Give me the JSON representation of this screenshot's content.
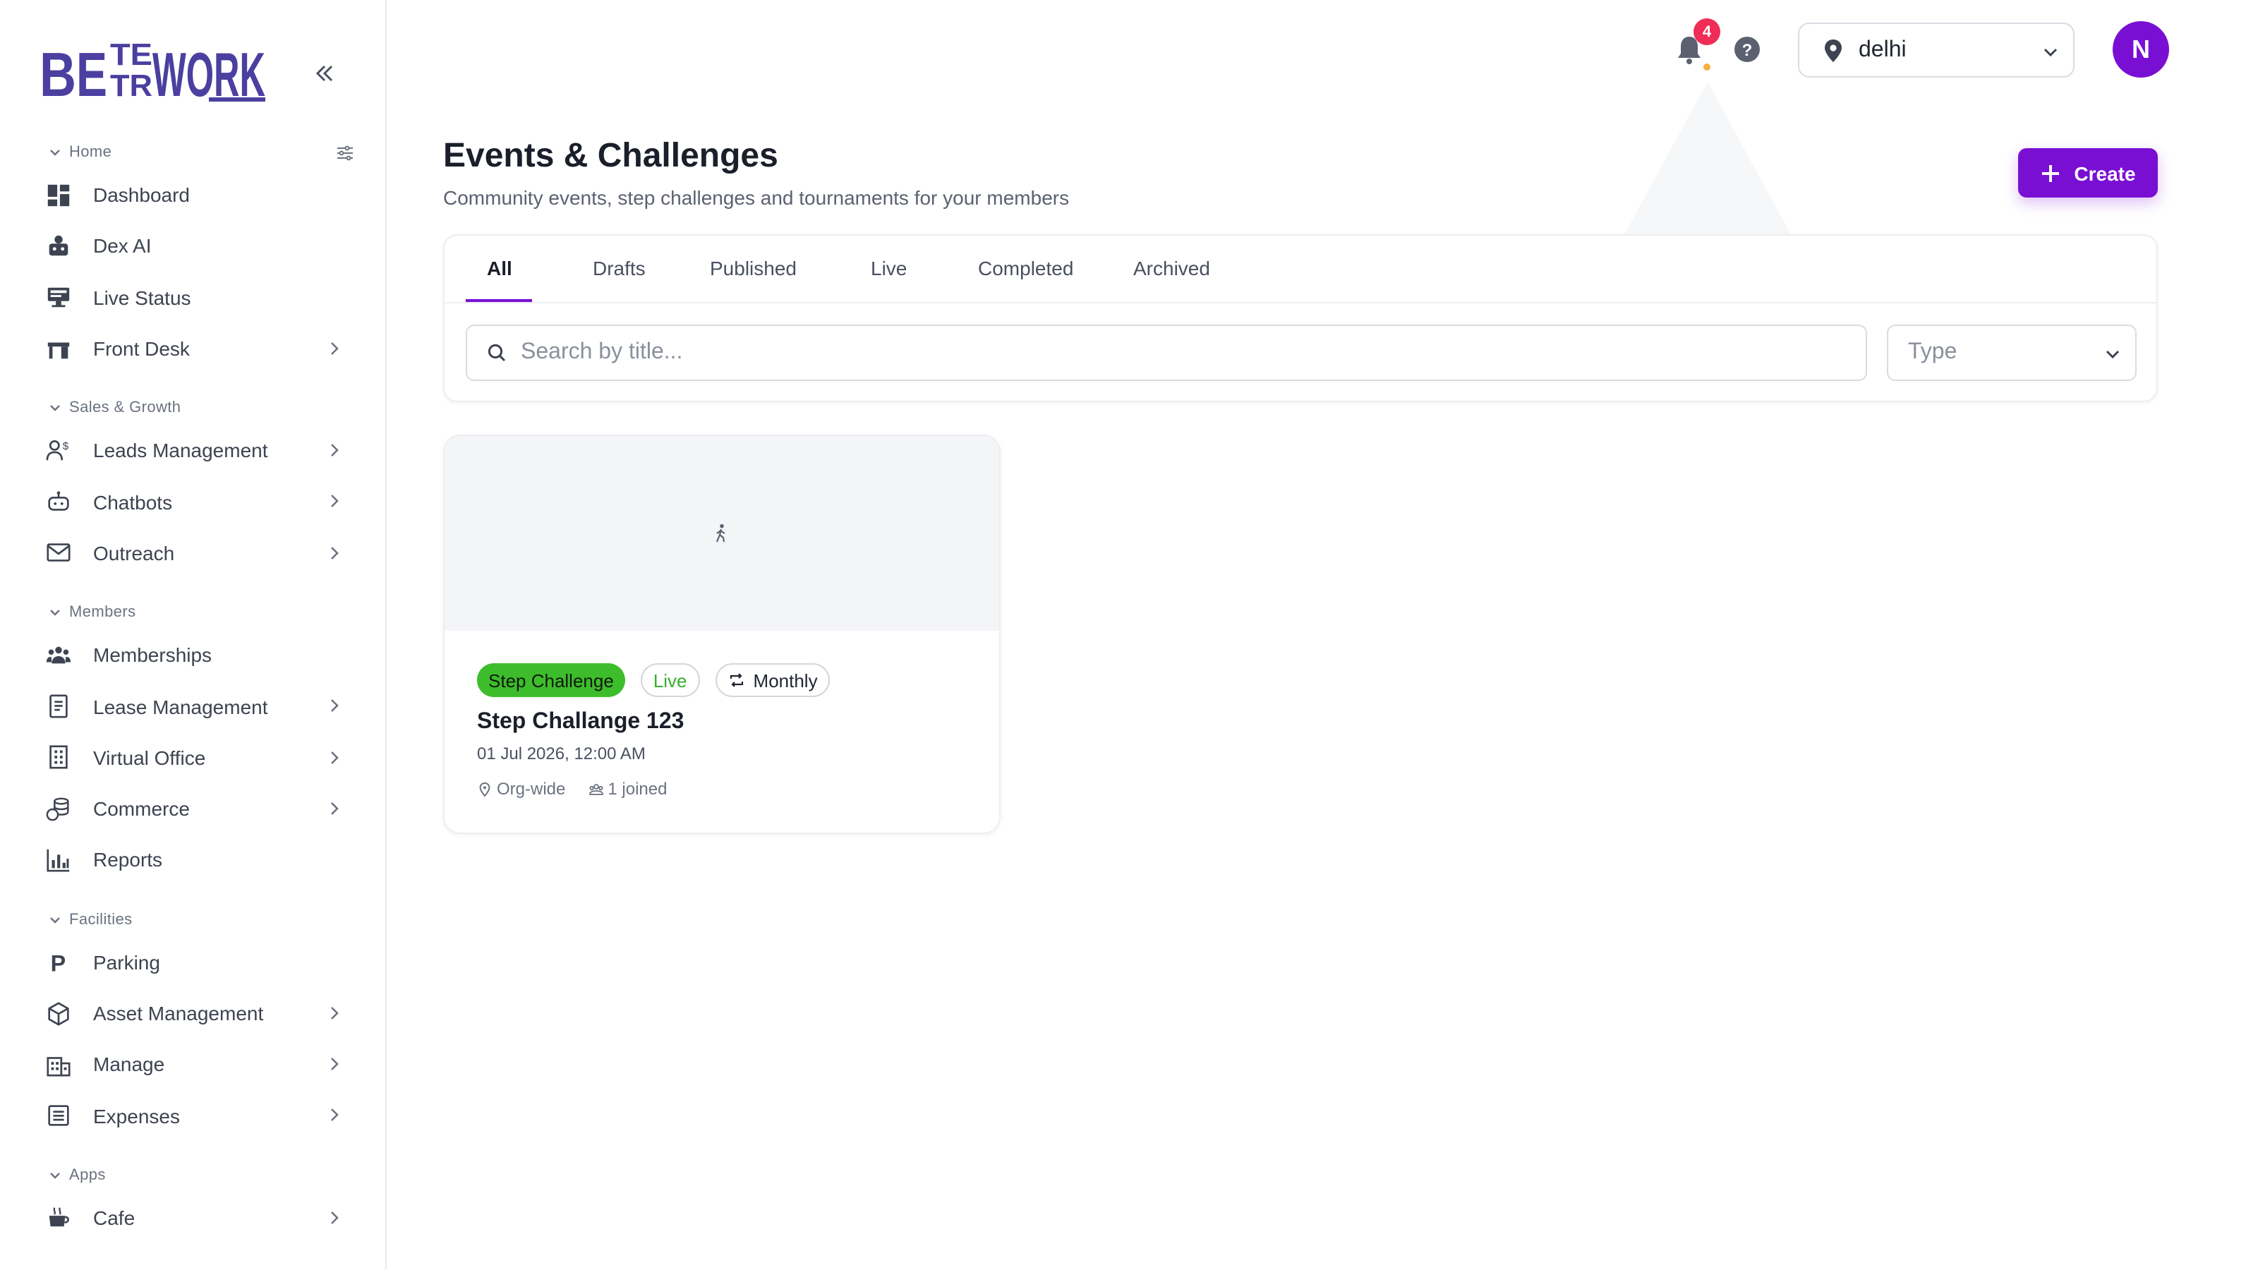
{
  "brand": {
    "logo_text": "BETTERWORK",
    "accent": "#7a0fd4",
    "logo_color": "#4b3fa0"
  },
  "sidebar": {
    "sections": [
      {
        "title": "Home",
        "items": [
          {
            "label": "Dashboard",
            "icon": "dashboard-icon",
            "has_arrow": false
          },
          {
            "label": "Dex AI",
            "icon": "robot-icon",
            "has_arrow": false
          },
          {
            "label": "Live Status",
            "icon": "monitor-icon",
            "has_arrow": false
          },
          {
            "label": "Front Desk",
            "icon": "desk-icon",
            "has_arrow": true
          }
        ]
      },
      {
        "title": "Sales & Growth",
        "items": [
          {
            "label": "Leads Management",
            "icon": "leads-icon",
            "has_arrow": true
          },
          {
            "label": "Chatbots",
            "icon": "chatbot-icon",
            "has_arrow": true
          },
          {
            "label": "Outreach",
            "icon": "mail-icon",
            "has_arrow": true
          }
        ]
      },
      {
        "title": "Members",
        "items": [
          {
            "label": "Memberships",
            "icon": "people-icon",
            "has_arrow": false
          },
          {
            "label": "Lease Management",
            "icon": "document-icon",
            "has_arrow": true
          },
          {
            "label": "Virtual Office",
            "icon": "building-icon",
            "has_arrow": true
          },
          {
            "label": "Commerce",
            "icon": "coins-icon",
            "has_arrow": true
          },
          {
            "label": "Reports",
            "icon": "bar-chart-icon",
            "has_arrow": false
          }
        ]
      },
      {
        "title": "Facilities",
        "items": [
          {
            "label": "Parking",
            "icon": "parking-icon",
            "has_arrow": false
          },
          {
            "label": "Asset Management",
            "icon": "cube-icon",
            "has_arrow": true
          },
          {
            "label": "Manage",
            "icon": "office-icon",
            "has_arrow": true
          },
          {
            "label": "Expenses",
            "icon": "list-icon",
            "has_arrow": true
          }
        ]
      },
      {
        "title": "Apps",
        "items": [
          {
            "label": "Cafe",
            "icon": "cafe-icon",
            "has_arrow": true
          }
        ]
      }
    ]
  },
  "header": {
    "notification_count": "4",
    "location": "delhi"
  },
  "user": {
    "initial": "N"
  },
  "page": {
    "title": "Events & Challenges",
    "subtitle": "Community events, step challenges and tournaments for your members",
    "create_label": "Create"
  },
  "tabs": [
    "All",
    "Drafts",
    "Published",
    "Live",
    "Completed",
    "Archived"
  ],
  "active_tab": "All",
  "search": {
    "placeholder": "Search by title...",
    "value": ""
  },
  "type_filter": {
    "placeholder": "Type"
  },
  "events": [
    {
      "type_chip": "Step Challenge",
      "status_chip": "Live",
      "frequency_chip": "Monthly",
      "title": "Step Challange 123",
      "date": "01 Jul 2026, 12:00 AM",
      "scope": "Org-wide",
      "joined": "1 joined"
    }
  ]
}
